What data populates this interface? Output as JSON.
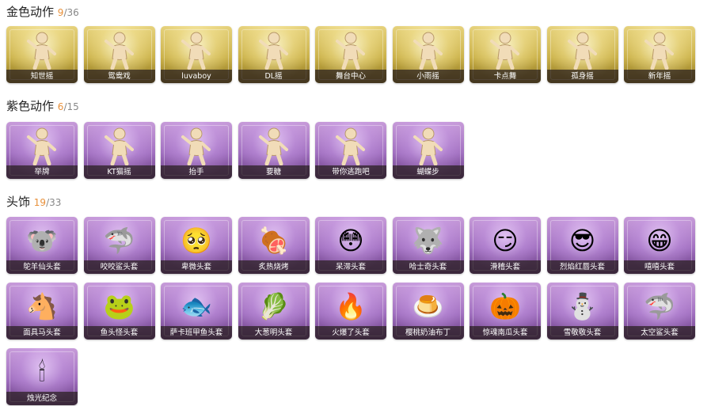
{
  "sections": {
    "gold": {
      "title": "金色动作",
      "owned": "9",
      "total": "/36"
    },
    "purple": {
      "title": "紫色动作",
      "owned": "6",
      "total": "/15"
    },
    "headwear": {
      "title": "头饰",
      "owned": "19",
      "total": "/33"
    }
  },
  "gold_items": [
    {
      "label": "知世摇",
      "icon": "dance-figure-icon"
    },
    {
      "label": "鸳鸯戏",
      "icon": "dance-figure-icon"
    },
    {
      "label": "luvaboy",
      "icon": "dance-figure-icon"
    },
    {
      "label": "DL摇",
      "icon": "dance-figure-icon"
    },
    {
      "label": "舞台中心",
      "icon": "dance-figure-icon"
    },
    {
      "label": "小雨摇",
      "icon": "dance-figure-icon"
    },
    {
      "label": "卡点舞",
      "icon": "dance-figure-icon"
    },
    {
      "label": "孤身摇",
      "icon": "dance-figure-icon"
    },
    {
      "label": "新年摇",
      "icon": "dance-figure-icon"
    }
  ],
  "purple_items": [
    {
      "label": "举牌",
      "icon": "dance-figure-icon"
    },
    {
      "label": "KT猫摇",
      "icon": "dance-figure-icon"
    },
    {
      "label": "抬手",
      "icon": "dance-figure-icon"
    },
    {
      "label": "要糖",
      "icon": "dance-figure-icon"
    },
    {
      "label": "带你逃跑吧",
      "icon": "dance-figure-icon"
    },
    {
      "label": "蝴蝶步",
      "icon": "dance-figure-icon"
    }
  ],
  "headwear_items": [
    {
      "label": "鸵羊仙头套",
      "icon": "koala-head-icon",
      "glyph": "🐨"
    },
    {
      "label": "咬咬鲨头套",
      "icon": "shark-head-icon",
      "glyph": "🦈"
    },
    {
      "label": "卑微头套",
      "icon": "shy-face-icon",
      "glyph": "🥺"
    },
    {
      "label": "炙热烧烤",
      "icon": "grill-face-icon",
      "glyph": "🍖"
    },
    {
      "label": "呆滞头套",
      "icon": "dazed-face-icon",
      "glyph": "😳"
    },
    {
      "label": "哈士奇头套",
      "icon": "husky-head-icon",
      "glyph": "🐺"
    },
    {
      "label": "滑稽头套",
      "icon": "funny-face-icon",
      "glyph": "😏"
    },
    {
      "label": "烈焰红唇头套",
      "icon": "red-lips-face-icon",
      "glyph": "😎"
    },
    {
      "label": "嘻嘻头套",
      "icon": "grin-face-icon",
      "glyph": "😁"
    },
    {
      "label": "面具马头套",
      "icon": "horse-head-icon",
      "glyph": "🐴"
    },
    {
      "label": "鱼头怪头套",
      "icon": "fish-monster-head-icon",
      "glyph": "🐸"
    },
    {
      "label": "萨卡班甲鱼头套",
      "icon": "armored-fish-head-icon",
      "glyph": "🐟"
    },
    {
      "label": "大葱明头套",
      "icon": "scallion-head-icon",
      "glyph": "🥬"
    },
    {
      "label": "火爆了头套",
      "icon": "fire-head-icon",
      "glyph": "🔥"
    },
    {
      "label": "樱桃奶油布丁",
      "icon": "pudding-head-icon",
      "glyph": "🍮"
    },
    {
      "label": "惊魂南瓜头套",
      "icon": "pumpkin-head-icon",
      "glyph": "🎃"
    },
    {
      "label": "雪敬敬头套",
      "icon": "snowman-head-icon",
      "glyph": "⛄"
    },
    {
      "label": "太空鲨头套",
      "icon": "space-shark-head-icon",
      "glyph": "🦈"
    },
    {
      "label": "烛光纪念",
      "icon": "candle-icon",
      "glyph": "🕯"
    }
  ]
}
